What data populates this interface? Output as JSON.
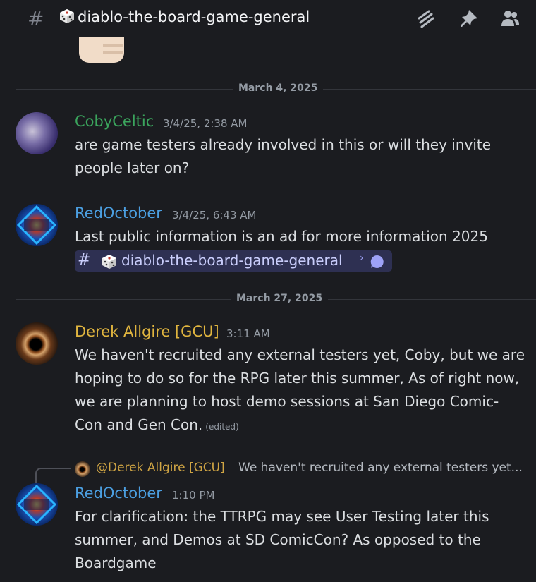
{
  "channel": {
    "name": "diablo-the-board-game-general",
    "icon": "dice-icon"
  },
  "header_icons": [
    "threads-icon",
    "pin-icon",
    "members-icon"
  ],
  "colors": {
    "background": "#1b1c20",
    "coby": "#3ba55d",
    "redoctober": "#4b9ee0",
    "derek": "#e0b53f"
  },
  "dividers": [
    {
      "label": "March 4, 2025"
    },
    {
      "label": "March 27, 2025"
    }
  ],
  "messages": [
    {
      "author": "CobyCeltic",
      "timestamp": "3/4/25, 2:38 AM",
      "lines": [
        "are game testers already involved in this or will they invite",
        "people later on?"
      ]
    },
    {
      "author": "RedOctober",
      "timestamp": "3/4/25, 6:43 AM",
      "lines": [
        "Last public information is an ad for more information 2025"
      ],
      "channel_mention": "diablo-the-board-game-general"
    },
    {
      "author": "Derek Allgire [GCU]",
      "timestamp": "3:11 AM",
      "lines": [
        "We haven't recruited any external testers yet, Coby, but we are",
        "hoping to do so for the RPG later this summer, As of right now,",
        "we are planning to host demo sessions at San Diego Comic-",
        "Con and Gen Con."
      ],
      "edited": "(edited)"
    },
    {
      "reply_to": {
        "author": "@Derek Allgire [GCU]",
        "preview": "We haven't recruited any external testers yet..."
      },
      "author": "RedOctober",
      "timestamp": "1:10 PM",
      "lines": [
        "For clarification:  the TTRPG may see User Testing later this",
        "summer, and Demos at SD ComicCon? As opposed to the",
        "Boardgame"
      ]
    }
  ]
}
